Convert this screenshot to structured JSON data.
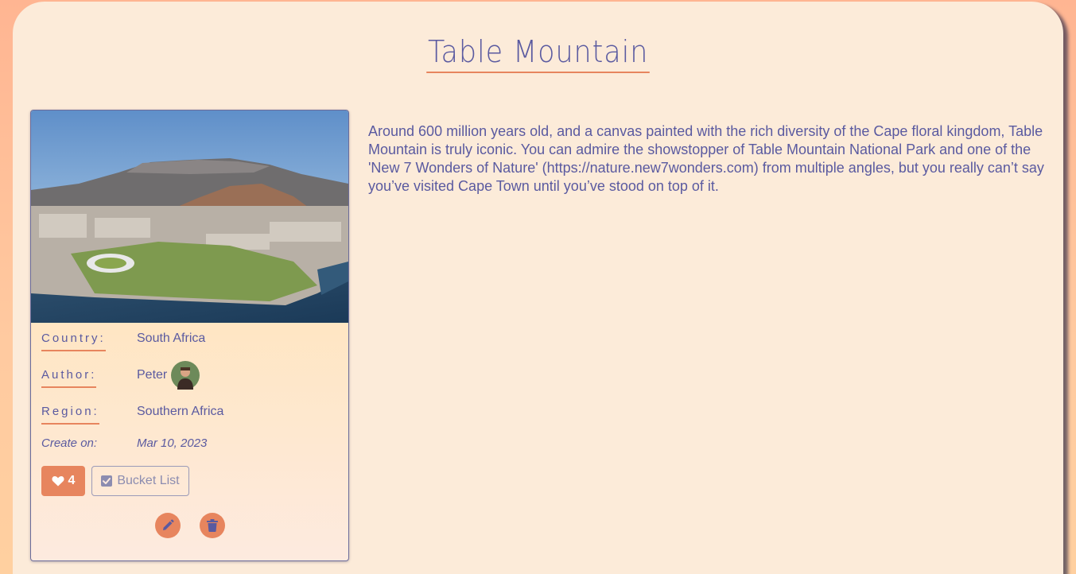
{
  "page": {
    "title": "Table Mountain",
    "description": "Around 600 million years old, and a canvas painted with the rich diversity of the Cape floral kingdom, Table Mountain is truly iconic. You can admire the showstopper of Table Mountain National Park and one of the 'New 7 Wonders of Nature' (https://nature.new7wonders.com) from multiple angles, but you really can’t say you’ve visited Cape Town until you’ve stood on top of it."
  },
  "card": {
    "country_label": "Country:",
    "country_value": "South Africa",
    "author_label": "Author:",
    "author_value": "Peter",
    "region_label": "Region:",
    "region_value": "Southern Africa",
    "created_label": "Create on:",
    "created_value": "Mar 10, 2023",
    "likes_count": "4",
    "bucket_label": "Bucket List"
  },
  "icons": {
    "like": "heart-icon",
    "bucket": "checkbox-icon",
    "edit": "pencil-icon",
    "delete": "trash-icon"
  },
  "colors": {
    "accent": "#e7855e",
    "text": "#5a5aa0",
    "panel": "#fcebd9",
    "background": "#ffb592"
  }
}
